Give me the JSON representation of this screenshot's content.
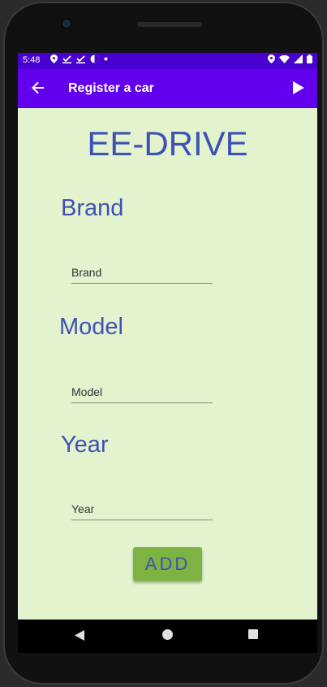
{
  "status_bar": {
    "time": "5:48",
    "left_icons": [
      "location-icon",
      "check-download-icon",
      "check-download-icon",
      "app-icon",
      "dot-icon"
    ],
    "right_icons": [
      "location-icon",
      "wifi-icon",
      "signal-icon",
      "battery-icon"
    ]
  },
  "app_bar": {
    "title": "Register a car",
    "back_icon": "arrow-back-icon",
    "action_icon": "play-icon",
    "color": "#6200ee"
  },
  "main": {
    "heading": "EE-DRIVE",
    "brand_label": "Brand",
    "brand_placeholder": "Brand",
    "model_label": "Model",
    "model_placeholder": "Model",
    "year_label": "Year",
    "year_placeholder": "Year",
    "add_button": "ADD",
    "background": "#e2f3cd",
    "accent": "#3f51b5",
    "button_color": "#7cb342"
  },
  "nav_bar": {
    "icons": [
      "nav-back-icon",
      "nav-home-icon",
      "nav-recents-icon"
    ]
  }
}
